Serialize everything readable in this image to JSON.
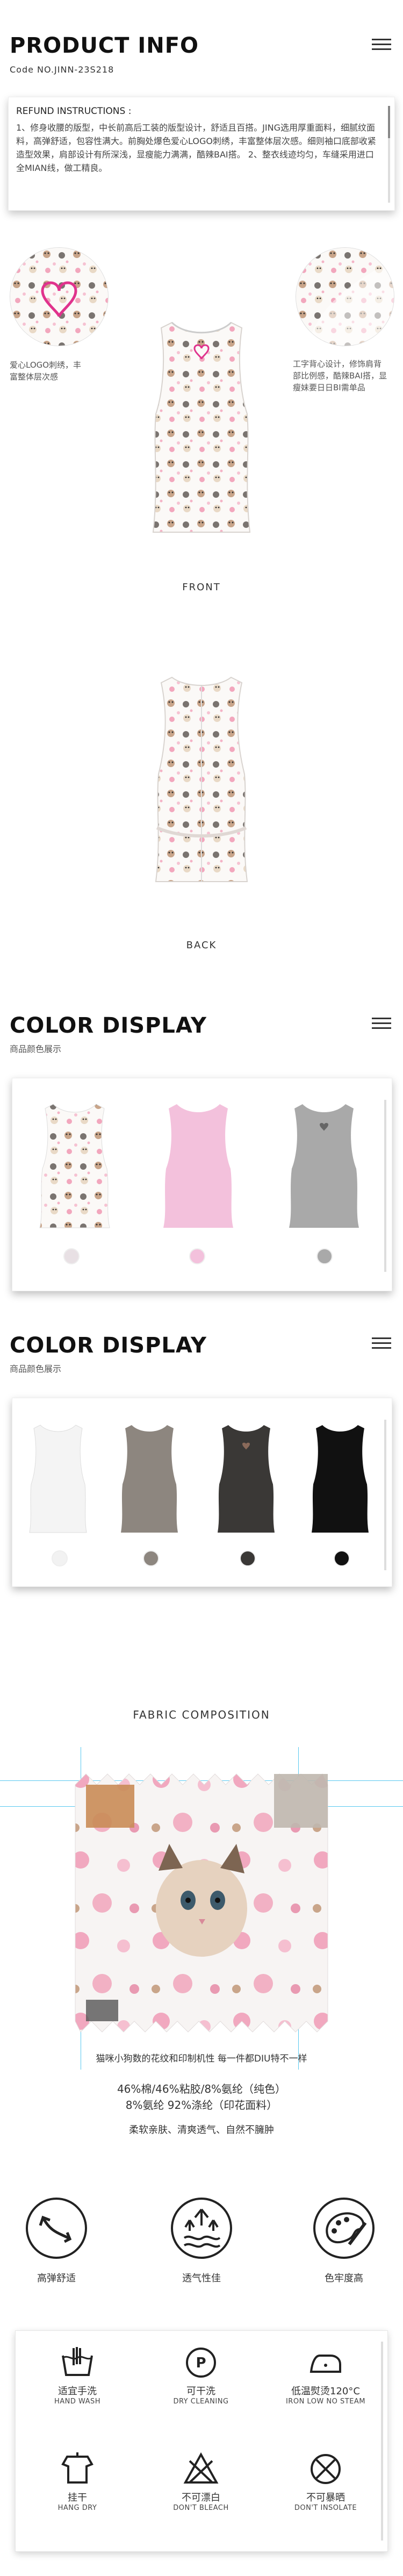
{
  "product": {
    "title": "PRODUCT INFO",
    "code": "Code NO.JINN-23S218"
  },
  "refund": {
    "heading": "REFUND INSTRUCTIONS :",
    "text": "1、修身收腰的版型，中长前高后工装的版型设计，舒适且百搭。JING选用厚重面料，细腻纹面料，高弹舒适，包容性满大。前胸处爆色爱心LOGO刺绣，丰富整体层次感。细则袖口底部收紧造型效果，肩部设计有所深浅，显瘦能力满满，酷辣BAI搭。\n2、整衣线迹均匀，车缝采用进口全MIAN线，做工精良。"
  },
  "notes": {
    "left": "爱心LOGO刺绣，丰富整体层次感",
    "right": "工字背心设计，修饰肩背部比例感，酷辣BAI搭，显瘦妹要日日BI需单品"
  },
  "captions": {
    "front": "FRONT",
    "back": "BACK"
  },
  "color_display_1": {
    "title": "COLOR DISPLAY",
    "subtitle": "商品颜色展示",
    "swatches": [
      "#e8e0e4",
      "#f3c1dc",
      "#a9a9a9"
    ]
  },
  "color_display_2": {
    "title": "COLOR DISPLAY",
    "subtitle": "商品颜色展示",
    "swatches": [
      "#f2f2f2",
      "#8d867f",
      "#3a3836",
      "#111111"
    ]
  },
  "fabric": {
    "title": "FABRIC COMPOSITION",
    "line1": "猫咪小狗数的花纹和印制机性  每一件都DIU特不一样",
    "line2": "46%棉/46%粘胶/8%氨纶（纯色）",
    "line3": "8%氨纶  92%涤纶（印花面料）",
    "line4": "柔软亲肤、清爽透气、自然不臃肿"
  },
  "features": [
    {
      "label": "高弹舒适",
      "icon": "stretch-icon"
    },
    {
      "label": "透气性佳",
      "icon": "breathable-icon"
    },
    {
      "label": "色牢度高",
      "icon": "color-fastness-icon"
    }
  ],
  "care": [
    {
      "cn": "适宜手洗",
      "en": "HAND WASH",
      "icon": "hand-wash-icon"
    },
    {
      "cn": "可干洗",
      "en": "DRY CLEANING",
      "icon": "dry-clean-icon"
    },
    {
      "cn": "低温熨烫120°C",
      "en": "IRON LOW NO STEAM",
      "icon": "iron-icon"
    },
    {
      "cn": "挂干",
      "en": "HANG DRY",
      "icon": "hang-dry-icon"
    },
    {
      "cn": "不可漂白",
      "en": "DON'T BLEACH",
      "icon": "no-bleach-icon"
    },
    {
      "cn": "不可暴晒",
      "en": "DON'T INSOLATE",
      "icon": "no-insolate-icon"
    }
  ]
}
